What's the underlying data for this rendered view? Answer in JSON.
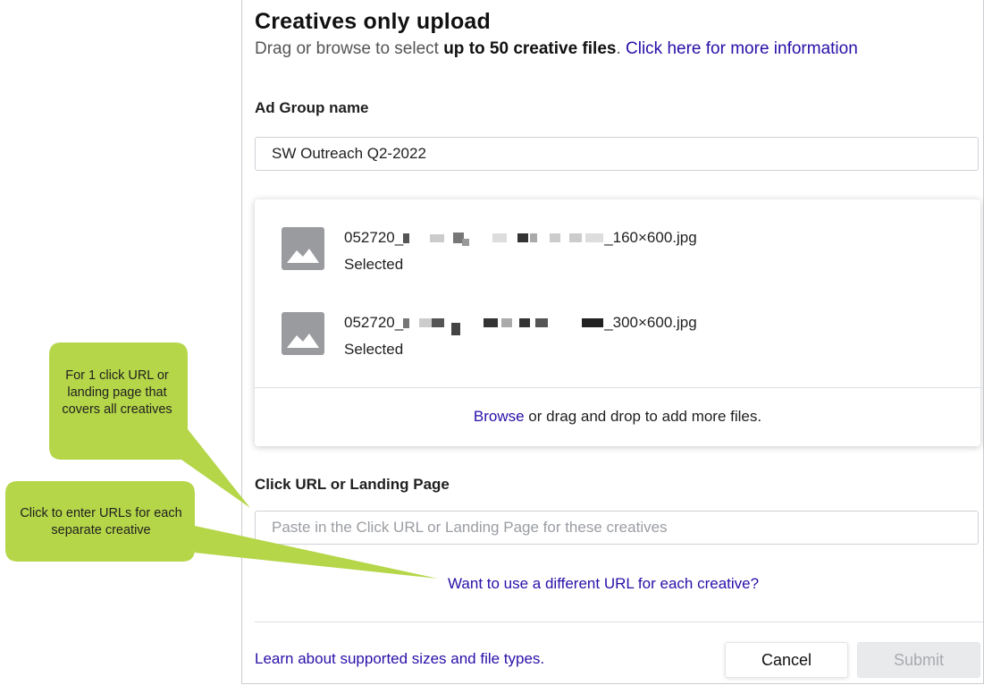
{
  "modal": {
    "title": "Creatives only upload",
    "subtitle_prefix": "Drag or browse to select ",
    "subtitle_bold": "up to 50 creative files",
    "subtitle_suffix": ". ",
    "info_link": "Click here for more information"
  },
  "ad_group": {
    "label": "Ad Group name",
    "value": "SW Outreach Q2-2022"
  },
  "files": [
    {
      "name_prefix": "052720_",
      "name_suffix": "_160×600.jpg",
      "status": "Selected",
      "icon": "image-icon"
    },
    {
      "name_prefix": "052720_",
      "name_suffix": "_300×600.jpg",
      "status": "Selected",
      "icon": "image-icon"
    }
  ],
  "upload": {
    "browse_link": "Browse",
    "browse_suffix": " or drag and drop to add more files."
  },
  "click_url": {
    "label": "Click URL or Landing Page",
    "placeholder": "Paste in the Click URL or Landing Page for these creatives",
    "value": "",
    "alt_link": "Want to use a different URL for each creative?"
  },
  "footer": {
    "learn_link": "Learn about supported sizes and file types.",
    "cancel_label": "Cancel",
    "submit_label": "Submit"
  },
  "callouts": [
    {
      "text": "For 1 click URL or landing page that covers all creatives",
      "color": "#b5d649"
    },
    {
      "text": "Click to enter URLs for each separate creative",
      "color": "#b5d649"
    }
  ],
  "colors": {
    "link": "#2a0fa8",
    "callout": "#b5d649",
    "thumb": "#9a9b9f"
  }
}
